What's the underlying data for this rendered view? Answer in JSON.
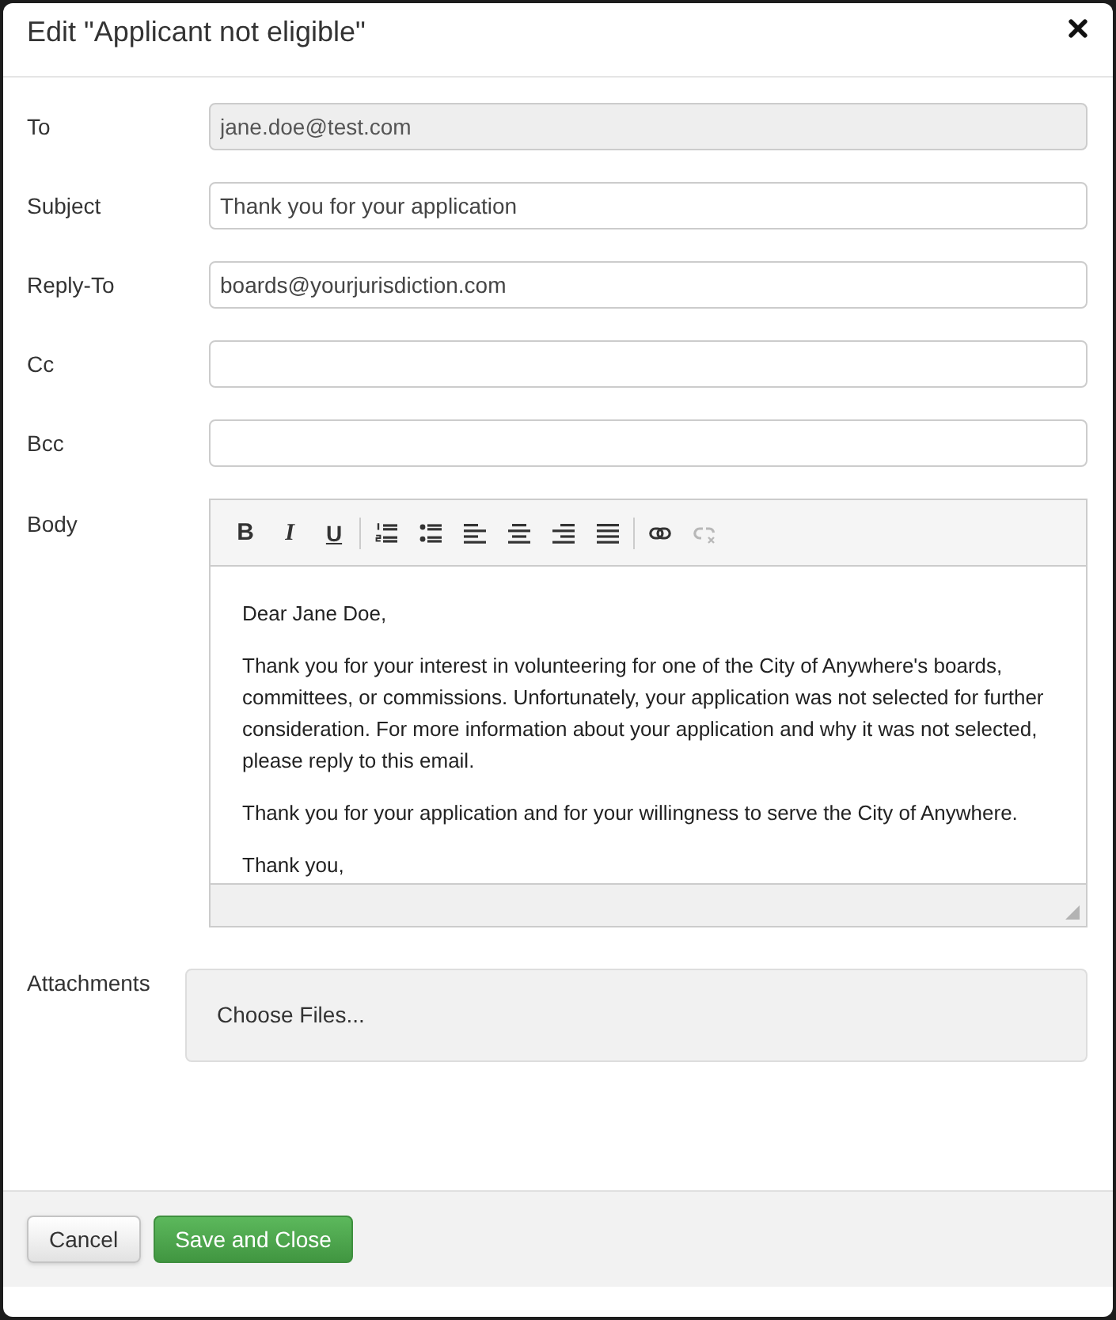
{
  "dialog": {
    "title": "Edit \"Applicant not eligible\""
  },
  "fields": [
    {
      "label": "To",
      "value": "jane.doe@test.com",
      "disabled": true
    },
    {
      "label": "Subject",
      "value": "Thank you for your application",
      "disabled": false
    },
    {
      "label": "Reply-To",
      "value": "boards@yourjurisdiction.com",
      "disabled": false
    },
    {
      "label": "Cc",
      "disabled": false
    },
    {
      "label": "Bcc",
      "disabled": false
    }
  ],
  "body": {
    "label": "Body",
    "toolbar": [
      {
        "buttons": [
          {
            "kind": "bold",
            "label": "B",
            "disabled": false
          },
          {
            "kind": "italic",
            "label": "I",
            "disabled": false
          },
          {
            "kind": "underline",
            "label": "U",
            "disabled": false
          }
        ]
      },
      {
        "buttons": [
          {
            "kind": "numbered-list",
            "disabled": false
          },
          {
            "kind": "bullet-list",
            "disabled": false
          },
          {
            "kind": "align-left",
            "disabled": false
          },
          {
            "kind": "align-center",
            "disabled": false
          },
          {
            "kind": "align-right",
            "disabled": false
          },
          {
            "kind": "justify",
            "disabled": false
          }
        ]
      },
      {
        "buttons": [
          {
            "kind": "link",
            "disabled": false
          },
          {
            "kind": "unlink",
            "disabled": true
          }
        ]
      }
    ],
    "paragraphs": [
      "Dear Jane Doe,",
      "Thank you for your interest in volunteering for one of the City of Anywhere's boards, committees, or commissions. Unfortunately, your application was not selected for further consideration. For more information about your application and why it was not selected, please reply to this email.",
      "Thank you for your application and for your willingness to serve the City of Anywhere.",
      "Thank you,"
    ]
  },
  "attachments": {
    "label": "Attachments",
    "dropzone": "Choose Files..."
  },
  "footer": {
    "buttons": [
      {
        "kind": "secondary",
        "label": "Cancel"
      },
      {
        "kind": "primary",
        "label": "Save and Close"
      }
    ]
  }
}
